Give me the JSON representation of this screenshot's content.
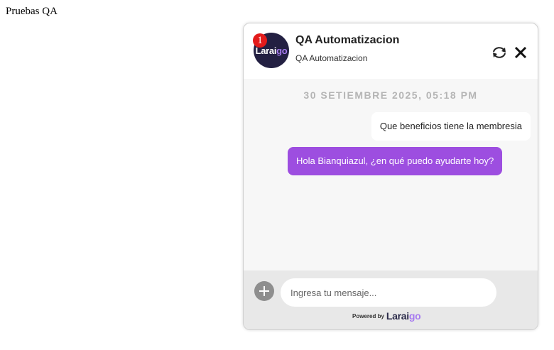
{
  "page": {
    "title": "Pruebas QA"
  },
  "widget": {
    "badge_count": "1",
    "avatar_logo": {
      "main": "Larai",
      "accent": "go"
    },
    "bot_name": "QA Automatizacion",
    "bot_subtitle": "QA Automatizacion",
    "icons": {
      "refresh": "refresh-icon",
      "close": "close-icon",
      "add": "plus-icon"
    }
  },
  "chat": {
    "date": "30 SETIEMBRE 2025, 05:18 PM",
    "messages": [
      {
        "from": "user",
        "text": "Que beneficios tiene la membresia"
      },
      {
        "from": "bot",
        "text": "Hola Bianquiazul, ¿en qué puedo ayudarte hoy?"
      }
    ]
  },
  "composer": {
    "placeholder": "Ingresa tu mensaje...",
    "value": "",
    "powered_by": "Powered by",
    "brand": {
      "main": "Larai",
      "accent": "go"
    }
  },
  "colors": {
    "bot_bubble": "#9d4ee0",
    "avatar_bg": "#232042",
    "badge": "#e31b1b",
    "brand_accent": "#a77bf0"
  }
}
